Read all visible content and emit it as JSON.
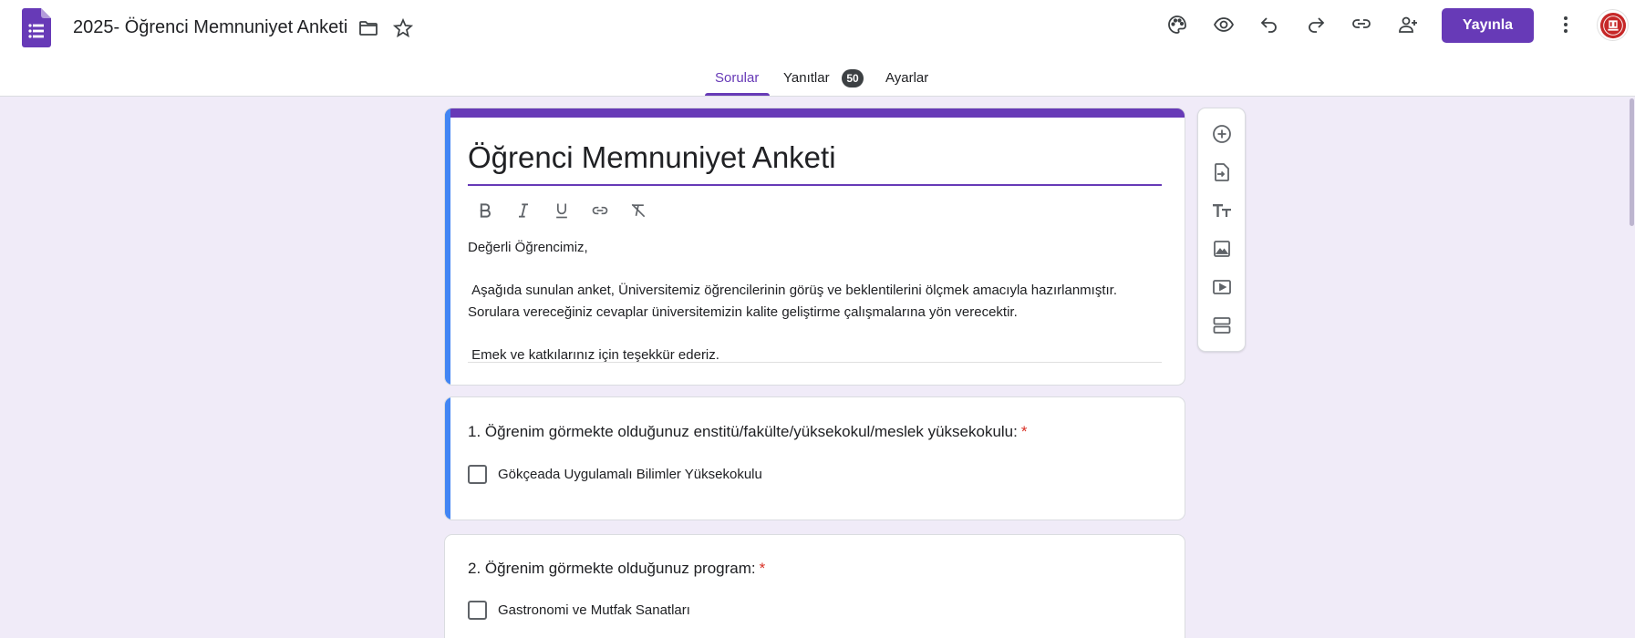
{
  "app": {
    "document_title": "2025- Öğrenci Memnuniyet Anketi",
    "publish_label": "Yayınla",
    "accent_color": "#673ab7",
    "background_color": "#f0ebf8",
    "header_icons": [
      "folder-icon",
      "star-icon",
      "palette-icon",
      "eye-icon",
      "undo-icon",
      "redo-icon",
      "link-icon",
      "add-collaborator-icon",
      "more-vert-icon"
    ]
  },
  "tabs": [
    {
      "label": "Sorular",
      "active": true
    },
    {
      "label": "Yanıtlar",
      "badge": "50"
    },
    {
      "label": "Ayarlar"
    }
  ],
  "form": {
    "title": "Öğrenci Memnuniyet Anketi",
    "description": "Değerli Öğrencimiz,\n\n Aşağıda sunulan anket, Üniversitemiz öğrencilerinin görüş ve beklentilerini ölçmek amacıyla hazırlanmıştır. \nSorulara vereceğiniz cevaplar üniversitemizin kalite geliştirme çalışmalarına yön verecektir.\n\n Emek ve katkılarınız için teşekkür ederiz.",
    "format_tools": [
      "bold-icon",
      "italic-icon",
      "underline-icon",
      "link-icon",
      "clear-format-icon"
    ]
  },
  "questions": [
    {
      "title": "1. Öğrenim görmekte olduğunuz enstitü/fakülte/yüksekokul/meslek yüksekokulu:",
      "required_mark": "*",
      "option": "Gökçeada Uygulamalı Bilimler Yüksekokulu"
    },
    {
      "title": "2. Öğrenim görmekte olduğunuz program:",
      "required_mark": "*",
      "option": "Gastronomi ve Mutfak Sanatları"
    }
  ],
  "side_toolbar": [
    "add-question-icon",
    "import-questions-icon",
    "add-title-icon",
    "add-image-icon",
    "add-video-icon",
    "add-section-icon"
  ]
}
